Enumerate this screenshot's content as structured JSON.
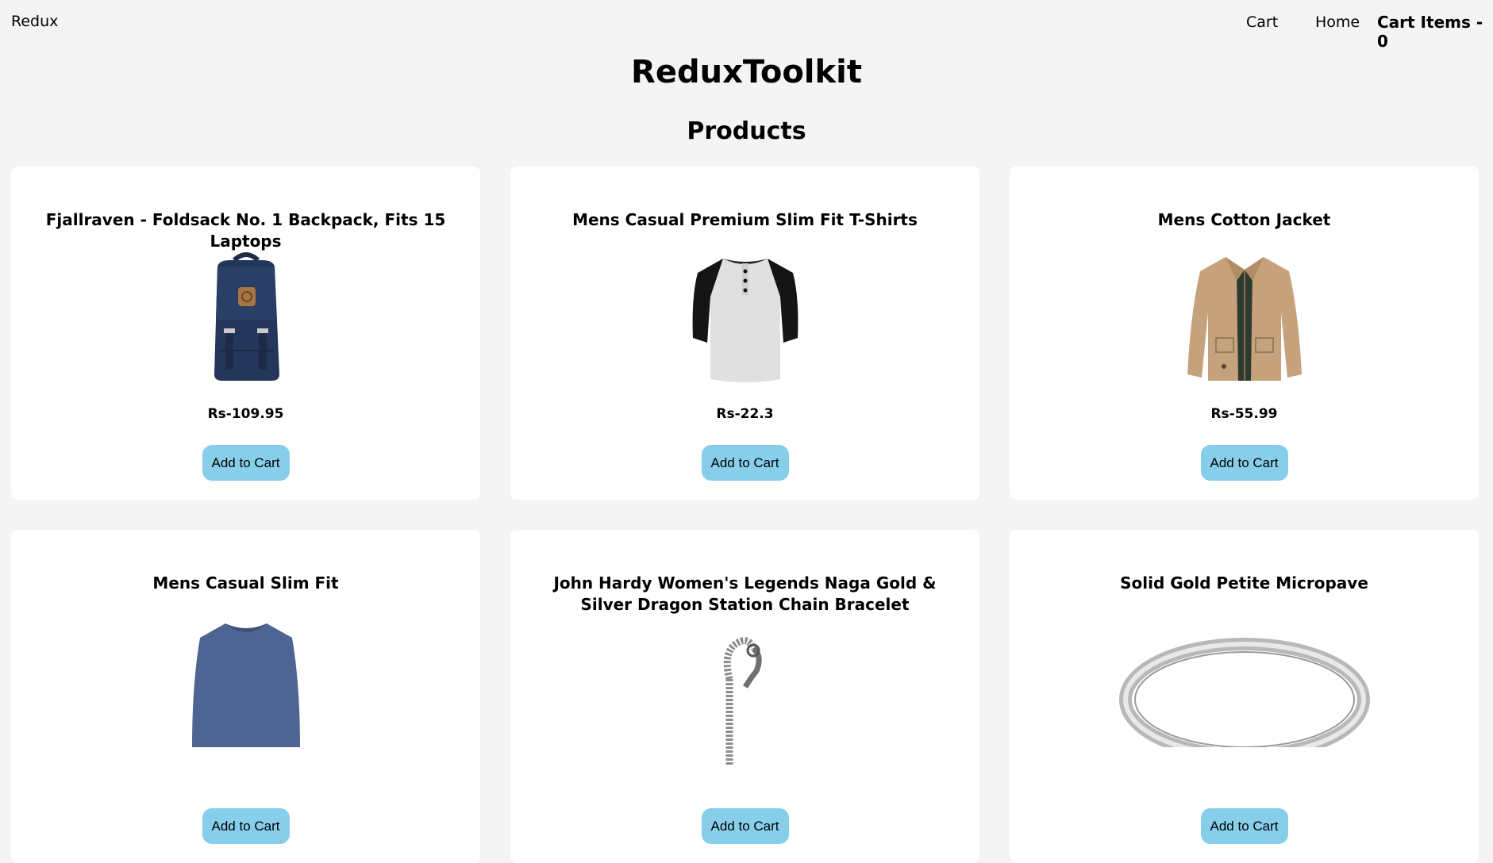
{
  "nav": {
    "brand": "Redux",
    "cart_link": "Cart",
    "home_link": "Home",
    "cart_count": "Cart Items - 0"
  },
  "page_title": "ReduxToolkit",
  "section_title": "Products",
  "products": [
    {
      "title": "Fjallraven - Foldsack No. 1 Backpack, Fits 15 Laptops",
      "price": "Rs-109.95",
      "button": "Add to Cart",
      "icon": "backpack-image"
    },
    {
      "title": "Mens Casual Premium Slim Fit T-Shirts",
      "price": "Rs-22.3",
      "button": "Add to Cart",
      "icon": "tshirt-image"
    },
    {
      "title": "Mens Cotton Jacket",
      "price": "Rs-55.99",
      "button": "Add to Cart",
      "icon": "jacket-image"
    },
    {
      "title": "Mens Casual Slim Fit",
      "price": "",
      "button": "Add to Cart",
      "icon": "longsleeve-shirt-image"
    },
    {
      "title": "John Hardy Women's Legends Naga Gold & Silver Dragon Station Chain Bracelet",
      "price": "",
      "button": "Add to Cart",
      "icon": "bracelet-image"
    },
    {
      "title": "Solid Gold Petite Micropave",
      "price": "",
      "button": "Add to Cart",
      "icon": "ring-image"
    }
  ],
  "colors": {
    "background": "#f4f4f4",
    "card": "#ffffff",
    "button": "#87ceeb"
  }
}
